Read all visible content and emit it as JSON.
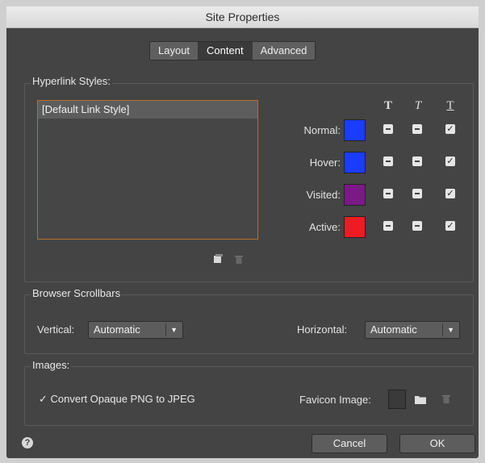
{
  "window": {
    "title": "Site Properties"
  },
  "tabs": [
    {
      "label": "Layout",
      "active": false
    },
    {
      "label": "Content",
      "active": true
    },
    {
      "label": "Advanced",
      "active": false
    }
  ],
  "hyperlink": {
    "group_label": "Hyperlink Styles:",
    "list_items": [
      "[Default Link Style]"
    ],
    "columns": [
      "T",
      "T",
      "T"
    ],
    "rows": [
      {
        "label": "Normal:",
        "color": "#1a3cff",
        "bold": false,
        "italic": false,
        "underline": true
      },
      {
        "label": "Hover:",
        "color": "#1a3cff",
        "bold": false,
        "italic": false,
        "underline": true
      },
      {
        "label": "Visited:",
        "color": "#7a1a86",
        "bold": false,
        "italic": false,
        "underline": true
      },
      {
        "label": "Active:",
        "color": "#ee1b24",
        "bold": false,
        "italic": false,
        "underline": true
      }
    ],
    "icons": [
      "new-style-icon",
      "trash-icon"
    ]
  },
  "scrollbars": {
    "group_label": "Browser Scrollbars",
    "vertical_label": "Vertical:",
    "vertical_value": "Automatic",
    "horizontal_label": "Horizontal:",
    "horizontal_value": "Automatic"
  },
  "images": {
    "group_label": "Images:",
    "convert_label": "Convert Opaque PNG to JPEG",
    "convert_checked": true,
    "favicon_label": "Favicon Image:"
  },
  "footer": {
    "cancel": "Cancel",
    "ok": "OK",
    "help_icon": "help-icon"
  }
}
